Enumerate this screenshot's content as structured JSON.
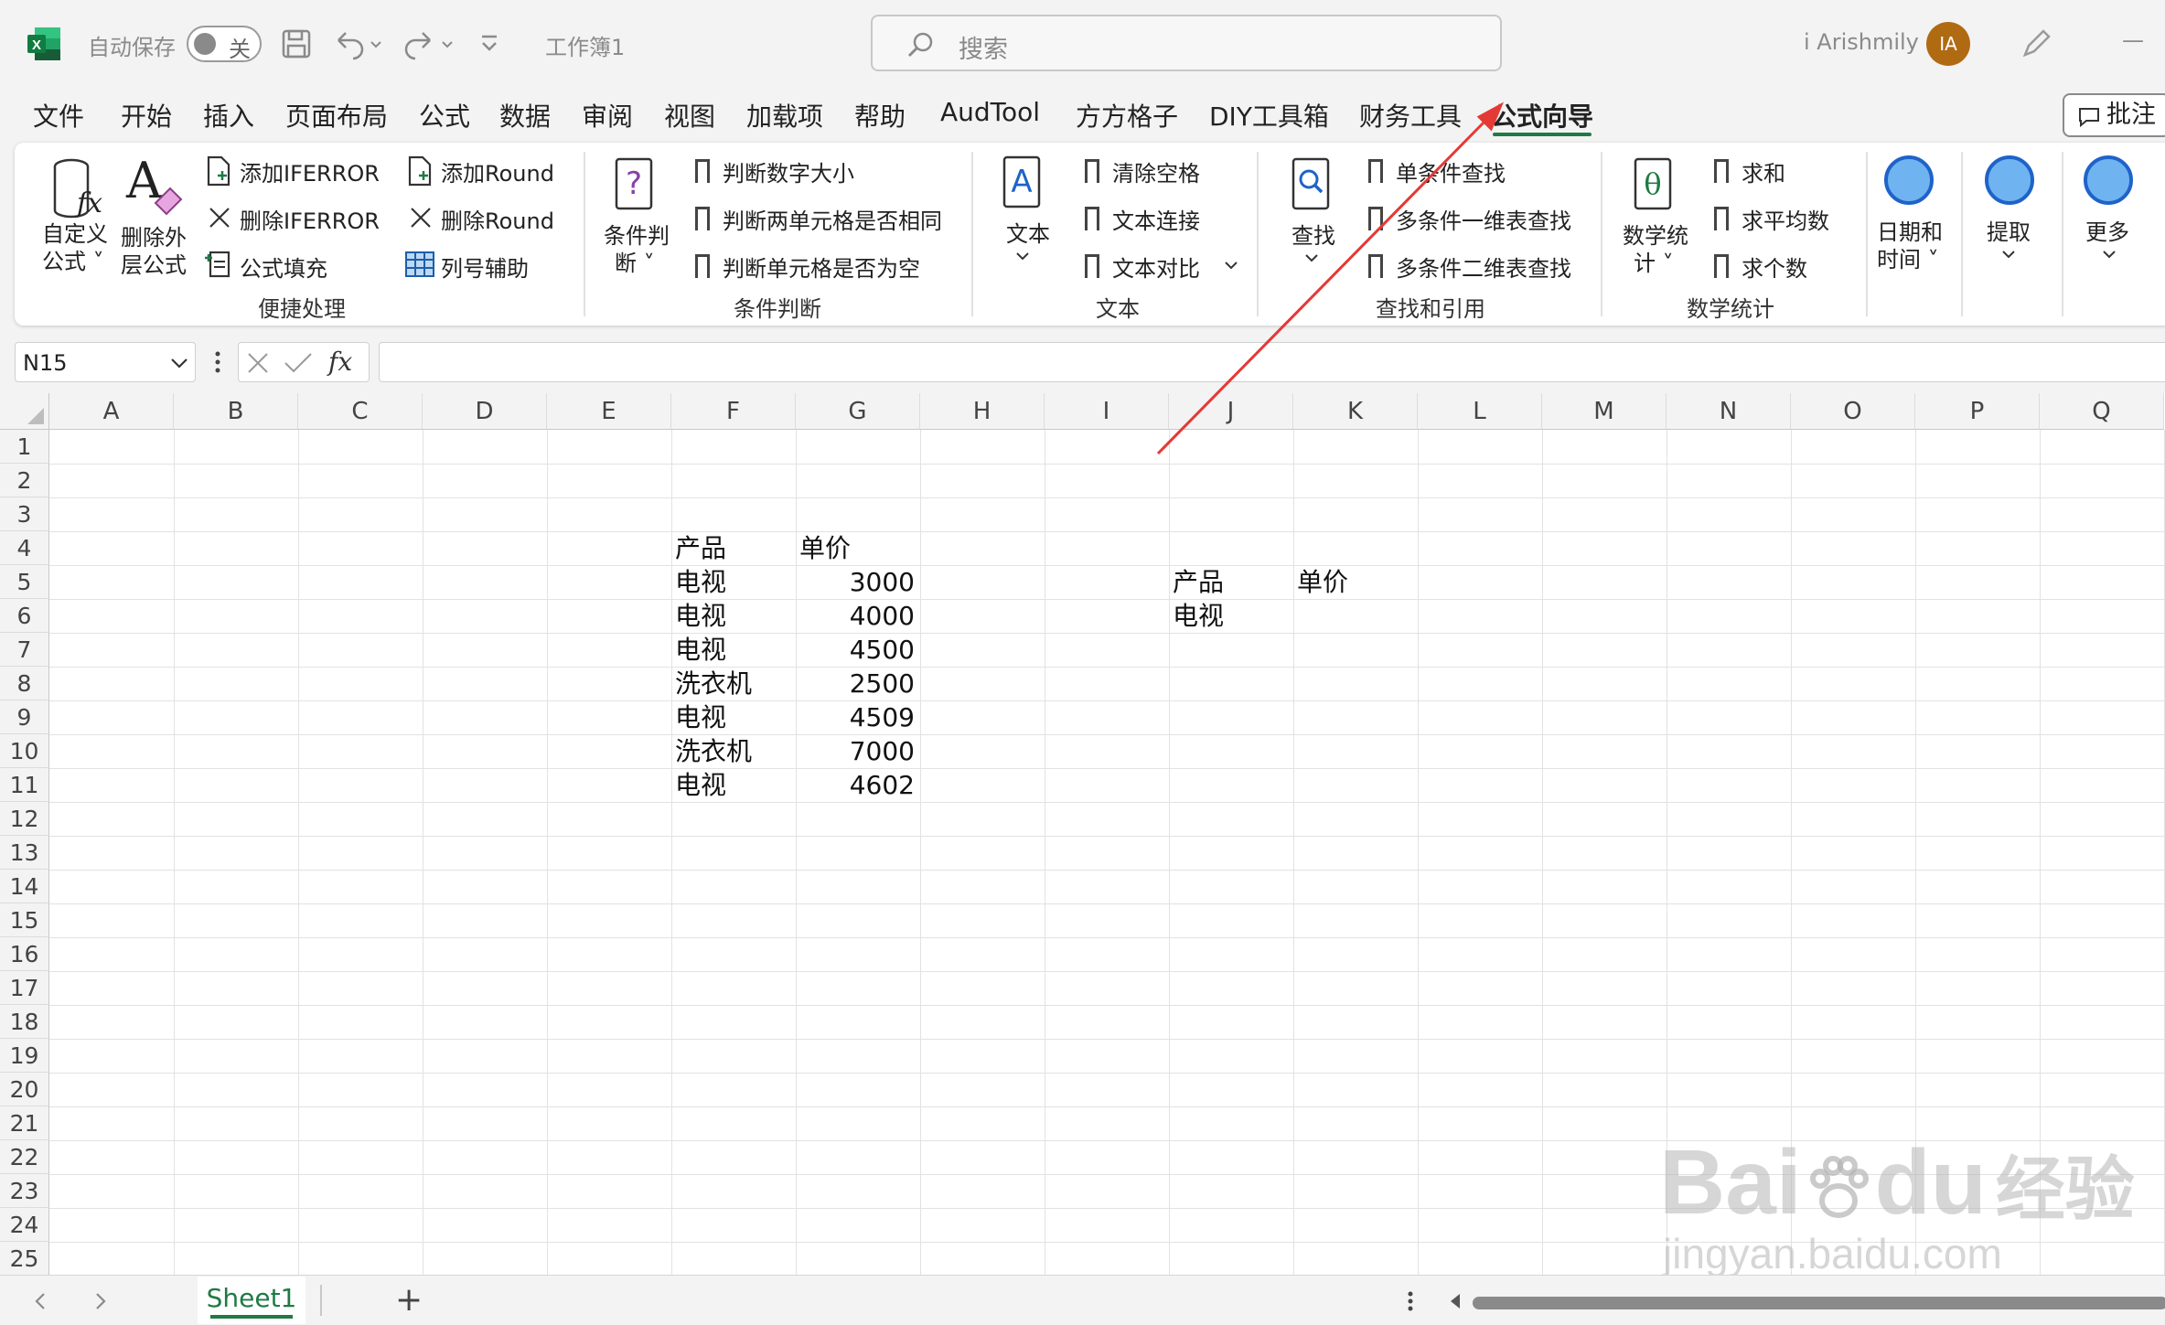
{
  "titlebar": {
    "autosave_label": "自动保存",
    "toggle_state": "关",
    "doc_title": "工作簿1",
    "search_placeholder": "搜索",
    "user_name": "i Arishmily",
    "avatar_initials": "IA",
    "minimize": "—"
  },
  "tabs": [
    {
      "label": "文件"
    },
    {
      "label": "开始"
    },
    {
      "label": "插入"
    },
    {
      "label": "页面布局"
    },
    {
      "label": "公式"
    },
    {
      "label": "数据"
    },
    {
      "label": "审阅"
    },
    {
      "label": "视图"
    },
    {
      "label": "加载项"
    },
    {
      "label": "帮助"
    },
    {
      "label": "AudTool"
    },
    {
      "label": "方方格子"
    },
    {
      "label": "DIY工具箱"
    },
    {
      "label": "财务工具"
    },
    {
      "label": "公式向导"
    }
  ],
  "comment_button": "批注",
  "ribbon": {
    "g1": {
      "custom_formula_1": "自定义",
      "custom_formula_2": "公式 ˅",
      "remove_outer_1": "删除外",
      "remove_outer_2": "层公式",
      "add_iferror": "添加IFERROR",
      "del_iferror": "删除IFERROR",
      "formula_fill": "公式填充",
      "add_round": "添加Round",
      "del_round": "删除Round",
      "col_helper": "列号辅助",
      "group": "便捷处理"
    },
    "g2": {
      "cond_1": "条件判",
      "cond_2": "断 ˅",
      "item1": "判断数字大小",
      "item2": "判断两单元格是否相同",
      "item3": "判断单元格是否为空",
      "group": "条件判断"
    },
    "g3": {
      "text": "文本",
      "item1": "清除空格",
      "item2": "文本连接",
      "item3": "文本对比",
      "group": "文本"
    },
    "g4": {
      "find": "查找",
      "item1": "单条件查找",
      "item2": "多条件一维表查找",
      "item3": "多条件二维表查找",
      "group": "查找和引用"
    },
    "g5": {
      "math_1": "数学统",
      "math_2": "计 ˅",
      "item1": "求和",
      "item2": "求平均数",
      "item3": "求个数",
      "group": "数学统计"
    },
    "g6": {
      "date_1": "日期和",
      "date_2": "时间 ˅",
      "extract": "提取",
      "more": "更多"
    }
  },
  "formula_bar": {
    "name_box": "N15",
    "fx": "fx",
    "formula": ""
  },
  "columns": [
    "A",
    "B",
    "C",
    "D",
    "E",
    "F",
    "G",
    "H",
    "I",
    "J",
    "K",
    "L",
    "M",
    "N",
    "O",
    "P",
    "Q"
  ],
  "rows": [
    "1",
    "2",
    "3",
    "4",
    "5",
    "6",
    "7",
    "8",
    "9",
    "10",
    "11",
    "12",
    "13",
    "14",
    "15",
    "16",
    "17",
    "18",
    "19",
    "20",
    "21",
    "22",
    "23",
    "24",
    "25"
  ],
  "cells": {
    "F4": "产品",
    "G4": "单价",
    "F5": "电视",
    "G5": "3000",
    "F6": "电视",
    "G6": "4000",
    "F7": "电视",
    "G7": "4500",
    "F8": "洗衣机",
    "G8": "2500",
    "F9": "电视",
    "G9": "4509",
    "F10": "洗衣机",
    "G10": "7000",
    "F11": "电视",
    "G11": "4602",
    "J5": "产品",
    "K5": "单价",
    "J6": "电视"
  },
  "sheet_tab": "Sheet1",
  "add_sheet": "+",
  "watermark": {
    "line1": "Bai",
    "line1b": "du",
    "line1c": "经验",
    "line2": "jingyan.baidu.com"
  },
  "colors": {
    "excel_green": "#1f7a44",
    "annotation_red": "#e53935",
    "avatar": "#b06a12",
    "ribbon_circle": "#1e63c9"
  }
}
